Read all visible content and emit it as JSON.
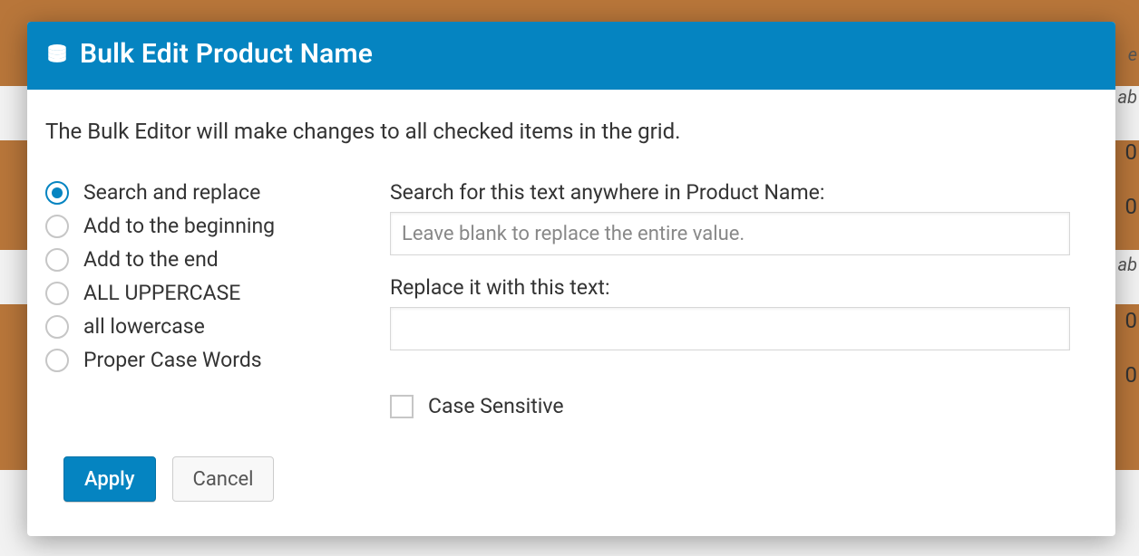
{
  "modal": {
    "title": "Bulk Edit Product Name",
    "intro": "The Bulk Editor will make changes to all checked items in the grid.",
    "operations": [
      {
        "label": "Search and replace"
      },
      {
        "label": "Add to the beginning"
      },
      {
        "label": "Add to the end"
      },
      {
        "label": "ALL UPPERCASE"
      },
      {
        "label": "all lowercase"
      },
      {
        "label": "Proper Case Words"
      }
    ],
    "selected_operation_index": 0,
    "search_label": "Search for this text anywhere in Product Name:",
    "search_placeholder": "Leave blank to replace the entire value.",
    "search_value": "",
    "replace_label": "Replace it with this text:",
    "replace_value": "",
    "case_sensitive_label": "Case Sensitive",
    "case_sensitive_checked": false,
    "apply_label": "Apply",
    "cancel_label": "Cancel"
  },
  "background": {
    "truncated_text_1": "e",
    "truncated_text_2": "ab",
    "truncated_text_3": "ab",
    "zero_values": [
      "0",
      "0",
      "0",
      "0"
    ]
  }
}
